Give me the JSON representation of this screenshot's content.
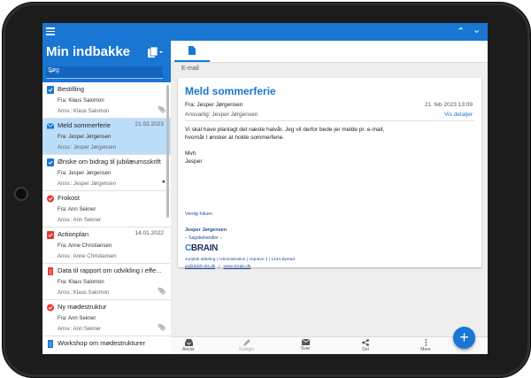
{
  "sidebar": {
    "title": "Min indbakke",
    "search_placeholder": "Søg",
    "items": [
      {
        "title": "Bestilling",
        "from": "Fra: Klaus Salomon",
        "resp": "Ansv.: Klaus Salomon",
        "date": "",
        "icon": "task-icon",
        "selected": false
      },
      {
        "title": "Meld sommerferie",
        "from": "Fra: Jesper Jørgensen",
        "resp": "Ansv.: Jesper Jørgensen",
        "date": "21.02.2023",
        "icon": "email-icon",
        "selected": true
      },
      {
        "title": "Ønske om bidrag til jubilæumsskrift",
        "from": "Fra: Jesper Jørgensen",
        "resp": "Ansv.: Jesper Jørgensen",
        "date": "",
        "icon": "task-icon",
        "selected": false
      },
      {
        "title": "Frokost",
        "from": "Fra: Ann Sekner",
        "resp": "Ansv.: Ann Sekner",
        "date": "",
        "icon": "check-circle-icon",
        "selected": false
      },
      {
        "title": "Actionplan",
        "from": "Fra: Anne Christiansen",
        "resp": "Ansv.: Anne Christiansen",
        "date": "14.01.2022",
        "icon": "task-red-icon",
        "selected": false
      },
      {
        "title": "Data til rapport om udvikling i effe...",
        "from": "Fra: Klaus Salomon",
        "resp": "Ansv.: Klaus Salomon",
        "date": "",
        "icon": "document-red-icon",
        "selected": false
      },
      {
        "title": "Ny mødestruktur",
        "from": "Fra: Ann Sekner",
        "resp": "Ansv.: Ann Sekner",
        "date": "",
        "icon": "check-circle-icon",
        "selected": false
      },
      {
        "title": "Workshop om mødestrukturer",
        "from": "",
        "resp": "",
        "date": "",
        "icon": "document-icon",
        "selected": false
      }
    ]
  },
  "main": {
    "section_label": "E-mail",
    "email": {
      "title": "Meld sommerferie",
      "from": "Fra: Jesper Jørgensen",
      "date": "21. feb 2023 13:09",
      "responsible": "Ansvarlig: Jesper Jørgensen",
      "details_link": "Vis detaljer",
      "body_line1": "Vi skal have planlagt det næste halvår. Jeg vil derfor bede jer melde pr. e-mail,",
      "body_line2": "hvornår I ønsker at holde sommerferie.",
      "closing": "Mvh",
      "closing_name": "Jesper",
      "greeting": "Venlig hilsen",
      "sig_name": "Jesper Jørgensen",
      "sig_role": "– Sagsbehandler –",
      "logo_c": "C",
      "logo_rest": "BRAIN",
      "sig_address": "Juridisk afdeling   |   Administration   |   Vejnavn 1   |   1234 Bystad",
      "sig_email": "jej@dddl-cbs.dk",
      "sig_sep": "   |   ",
      "sig_web": "www.cbrain.dk"
    }
  },
  "toolbar": {
    "reply": "Anvisr",
    "edit": "Redigér",
    "answer": "Svar",
    "share": "Del",
    "more": "Mere"
  },
  "colors": {
    "accent": "#1976d2",
    "selected_row": "#bbdefb"
  }
}
